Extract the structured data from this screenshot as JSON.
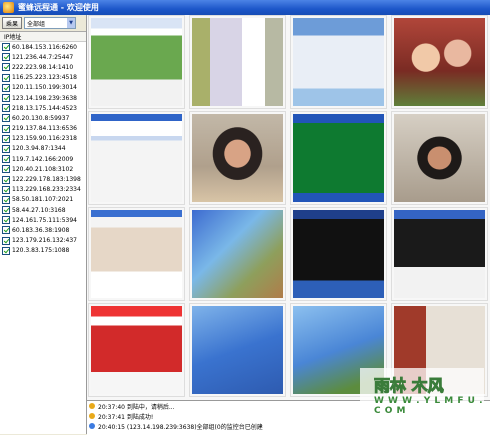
{
  "window": {
    "title": "蜜蜂远程通 - 欢迎使用"
  },
  "toolbar": {
    "refresh_label": "乘果",
    "group_value": "全部组"
  },
  "ip_list": {
    "header": "IP地址",
    "items": [
      "60.184.153.116:6260",
      "121.236.44.7:25447",
      "222.223.98.14:1410",
      "116.25.223.123:4518",
      "120.11.150.199:3014",
      "123.14.198.239:3638",
      "218.13.175.144:4523",
      "60.20.130.8:59937",
      "219.137.84.113:6536",
      "123.159.90.116:2318",
      "120.3.94.87:1344",
      "119.7.142.166:2009",
      "120.40.21.108:3102",
      "122.229.178.183:1398",
      "113.229.168.233:2334",
      "58.50.181.107:2021",
      "58.44.27.10:3168",
      "124.161.75.111:5394",
      "60.183.36.38:1908",
      "123.179.216.132:437",
      "120.3.83.175:1088"
    ]
  },
  "log": {
    "lines": [
      "20:37:40  到陆中，请稍后...",
      "20:37:41  到陆成功!",
      "20:40:15  (123.14.198.239:3638)全部组(0的监控台已创建"
    ]
  },
  "watermark": {
    "brand": "雨林 木风",
    "url": "W W W . Y L M F U . C O M"
  },
  "colors": {
    "titlebar": "#1d57c9",
    "accent_green": "#3a7c3a"
  }
}
